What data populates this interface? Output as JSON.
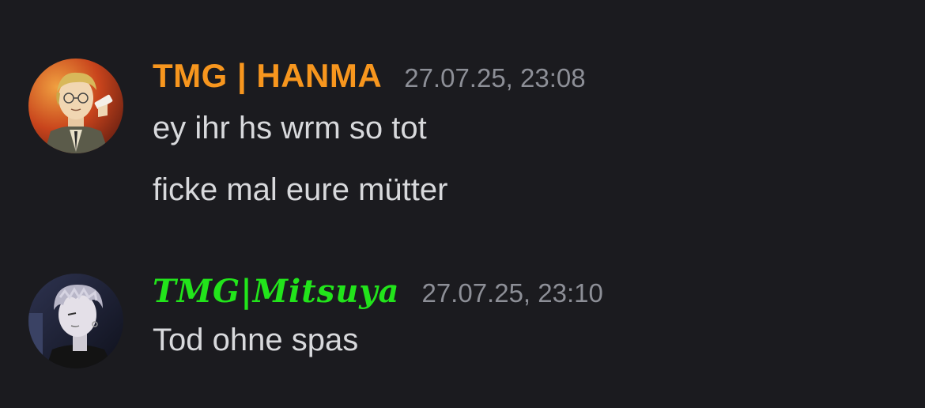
{
  "messages": [
    {
      "author": "TMG | HANMA",
      "author_color": "#f7961e",
      "timestamp": "27.07.25, 23:08",
      "avatar": "hanma-avatar",
      "lines": [
        "ey ihr hs wrm so tot",
        "ficke mal eure mütter"
      ]
    },
    {
      "author": "TMG|Mitsuya",
      "author_color": "#22e41b",
      "timestamp": "27.07.25, 23:10",
      "avatar": "mitsuya-avatar",
      "lines": [
        "Tod ohne spas"
      ]
    }
  ]
}
